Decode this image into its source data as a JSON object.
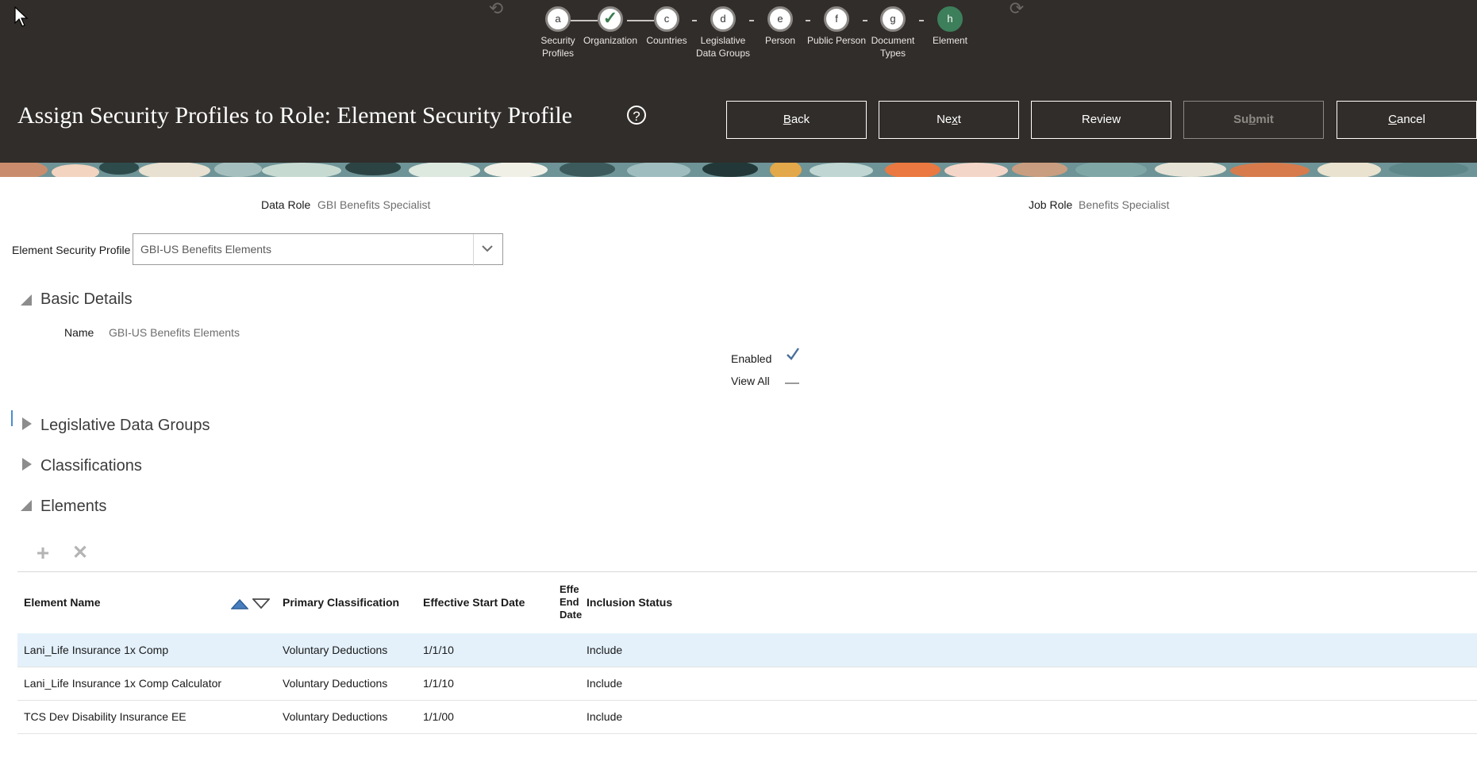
{
  "train": {
    "stops": [
      {
        "letter": "a",
        "label": "Security Profiles",
        "state": "visited"
      },
      {
        "letter": "",
        "label": "Organization",
        "state": "done"
      },
      {
        "letter": "c",
        "label": "Countries",
        "state": "visited"
      },
      {
        "letter": "d",
        "label": "Legislative Data Groups",
        "state": "visited"
      },
      {
        "letter": "e",
        "label": "Person",
        "state": "visited"
      },
      {
        "letter": "f",
        "label": "Public Person",
        "state": "visited"
      },
      {
        "letter": "g",
        "label": "Document Types",
        "state": "visited"
      },
      {
        "letter": "h",
        "label": "Element",
        "state": "current"
      }
    ]
  },
  "header": {
    "title": "Assign Security Profiles to Role: Element Security Profile",
    "help_glyph": "?",
    "buttons": {
      "back": {
        "pre": "",
        "key": "B",
        "post": "ack"
      },
      "next": {
        "pre": "Ne",
        "key": "x",
        "post": "t"
      },
      "review": {
        "label": "Review"
      },
      "submit": {
        "pre": "Su",
        "key": "b",
        "post": "mit"
      },
      "cancel": {
        "pre": "",
        "key": "C",
        "post": "ancel"
      }
    }
  },
  "role": {
    "data_role_label": "Data Role",
    "data_role_value": "GBI Benefits Specialist",
    "job_role_label": "Job Role",
    "job_role_value": "Benefits Specialist"
  },
  "profile_select": {
    "label": "Element Security Profile",
    "value": "GBI-US Benefits Elements"
  },
  "basic_details": {
    "title": "Basic Details",
    "name_label": "Name",
    "name_value": "GBI-US Benefits Elements",
    "enabled_label": "Enabled",
    "enabled_value": true,
    "view_all_label": "View All",
    "view_all_value": false
  },
  "sections": {
    "legislative": "Legislative Data Groups",
    "classifications": "Classifications",
    "elements": "Elements"
  },
  "toolbar": {
    "add_glyph": "+",
    "delete_glyph": "✕"
  },
  "table": {
    "columns": {
      "element_name": "Element Name",
      "primary_classification": "Primary Classification",
      "effective_start_date": "Effective Start Date",
      "effective_end_date_lines": [
        "Effe",
        "End",
        "Date"
      ],
      "inclusion_status": "Inclusion Status"
    },
    "rows": [
      {
        "name": "Lani_Life Insurance 1x Comp",
        "classification": "Voluntary Deductions",
        "start": "1/1/10",
        "end": "",
        "status": "Include",
        "selected": true
      },
      {
        "name": "Lani_Life Insurance 1x Comp Calculator",
        "classification": "Voluntary Deductions",
        "start": "1/1/10",
        "end": "",
        "status": "Include",
        "selected": false
      },
      {
        "name": "TCS Dev Disability Insurance EE",
        "classification": "Voluntary Deductions",
        "start": "1/1/00",
        "end": "",
        "status": "Include",
        "selected": false
      }
    ]
  },
  "colors": {
    "header_bg": "#312d2a",
    "current_step": "#3d7f5a",
    "selected_row": "#e4f1fb",
    "check": "#4a6f9a"
  }
}
